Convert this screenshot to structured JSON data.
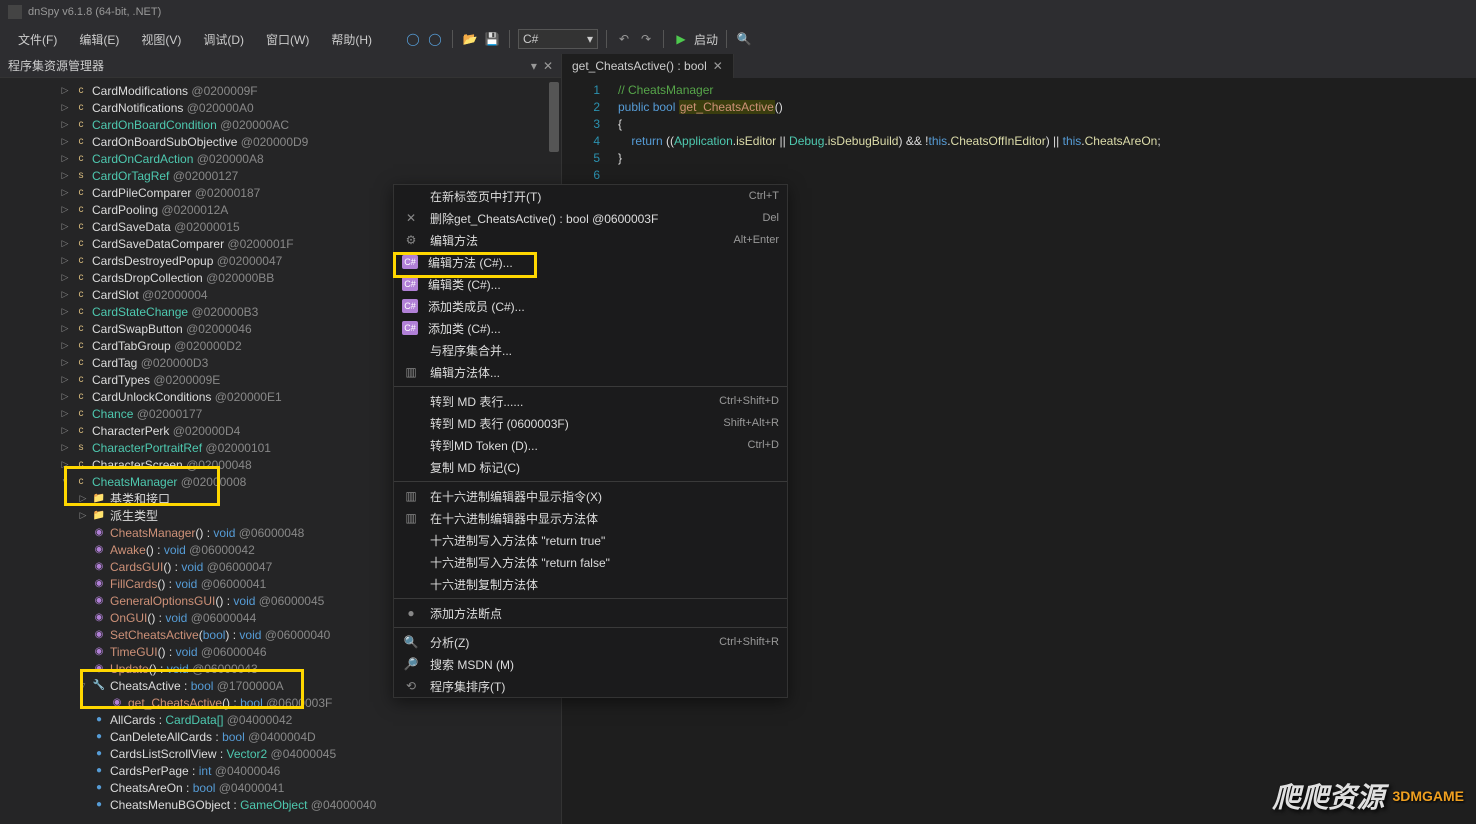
{
  "app": {
    "title": "dnSpy v6.1.8 (64-bit, .NET)"
  },
  "menu": {
    "file": "文件(F)",
    "edit": "编辑(E)",
    "view": "视图(V)",
    "debug": "调试(D)",
    "window": "窗口(W)",
    "help": "帮助(H)",
    "lang": "C#",
    "start": "启动"
  },
  "panel": {
    "title": "程序集资源管理器"
  },
  "items": [
    {
      "d": 0,
      "exp": "▷",
      "ic": "c",
      "icc": "ico-c",
      "nm": "CardModifications",
      "cls": "nm-white",
      "id": "@0200009F"
    },
    {
      "d": 0,
      "exp": "▷",
      "ic": "c",
      "icc": "ico-c",
      "nm": "CardNotifications",
      "cls": "nm-white",
      "id": "@020000A0"
    },
    {
      "d": 0,
      "exp": "▷",
      "ic": "c",
      "icc": "ico-c",
      "nm": "CardOnBoardCondition",
      "cls": "nm",
      "id": "@020000AC"
    },
    {
      "d": 0,
      "exp": "▷",
      "ic": "c",
      "icc": "ico-c",
      "nm": "CardOnBoardSubObjective",
      "cls": "nm-white",
      "id": "@020000D9"
    },
    {
      "d": 0,
      "exp": "▷",
      "ic": "c",
      "icc": "ico-c",
      "nm": "CardOnCardAction",
      "cls": "nm",
      "id": "@020000A8"
    },
    {
      "d": 0,
      "exp": "▷",
      "ic": "s",
      "icc": "ico-c",
      "nm": "CardOrTagRef",
      "cls": "nm",
      "id": "@02000127"
    },
    {
      "d": 0,
      "exp": "▷",
      "ic": "c",
      "icc": "ico-c",
      "nm": "CardPileComparer",
      "cls": "nm-white",
      "id": "@02000187"
    },
    {
      "d": 0,
      "exp": "▷",
      "ic": "c",
      "icc": "ico-c",
      "nm": "CardPooling",
      "cls": "nm-white",
      "id": "@0200012A"
    },
    {
      "d": 0,
      "exp": "▷",
      "ic": "c",
      "icc": "ico-c",
      "nm": "CardSaveData",
      "cls": "nm-white",
      "id": "@02000015"
    },
    {
      "d": 0,
      "exp": "▷",
      "ic": "c",
      "icc": "ico-c",
      "nm": "CardSaveDataComparer",
      "cls": "nm-white",
      "id": "@0200001F"
    },
    {
      "d": 0,
      "exp": "▷",
      "ic": "c",
      "icc": "ico-c",
      "nm": "CardsDestroyedPopup",
      "cls": "nm-white",
      "id": "@02000047"
    },
    {
      "d": 0,
      "exp": "▷",
      "ic": "c",
      "icc": "ico-c",
      "nm": "CardsDropCollection",
      "cls": "nm-white",
      "id": "@020000BB"
    },
    {
      "d": 0,
      "exp": "▷",
      "ic": "c",
      "icc": "ico-c",
      "nm": "CardSlot",
      "cls": "nm-white",
      "id": "@02000004"
    },
    {
      "d": 0,
      "exp": "▷",
      "ic": "c",
      "icc": "ico-c",
      "nm": "CardStateChange",
      "cls": "nm",
      "id": "@020000B3"
    },
    {
      "d": 0,
      "exp": "▷",
      "ic": "c",
      "icc": "ico-c",
      "nm": "CardSwapButton",
      "cls": "nm-white",
      "id": "@02000046"
    },
    {
      "d": 0,
      "exp": "▷",
      "ic": "c",
      "icc": "ico-c",
      "nm": "CardTabGroup",
      "cls": "nm-white",
      "id": "@020000D2"
    },
    {
      "d": 0,
      "exp": "▷",
      "ic": "c",
      "icc": "ico-c",
      "nm": "CardTag",
      "cls": "nm-white",
      "id": "@020000D3"
    },
    {
      "d": 0,
      "exp": "▷",
      "ic": "c",
      "icc": "ico-c",
      "nm": "CardTypes",
      "cls": "nm-white",
      "id": "@0200009E"
    },
    {
      "d": 0,
      "exp": "▷",
      "ic": "c",
      "icc": "ico-c",
      "nm": "CardUnlockConditions",
      "cls": "nm-white",
      "id": "@020000E1"
    },
    {
      "d": 0,
      "exp": "▷",
      "ic": "c",
      "icc": "ico-c",
      "nm": "Chance",
      "cls": "nm",
      "id": "@02000177"
    },
    {
      "d": 0,
      "exp": "▷",
      "ic": "c",
      "icc": "ico-c",
      "nm": "CharacterPerk",
      "cls": "nm-white",
      "id": "@020000D4"
    },
    {
      "d": 0,
      "exp": "▷",
      "ic": "s",
      "icc": "ico-c",
      "nm": "CharacterPortraitRef",
      "cls": "nm",
      "id": "@02000101"
    },
    {
      "d": 0,
      "exp": "▷",
      "ic": "c",
      "icc": "ico-c",
      "nm": "CharacterScreen",
      "cls": "nm-white",
      "id": "@02000048"
    },
    {
      "d": 0,
      "exp": "▿",
      "ic": "c",
      "icc": "ico-c",
      "nm": "CheatsManager",
      "cls": "nm",
      "id": "@02000008"
    },
    {
      "d": 2,
      "exp": "▷",
      "ic": "📁",
      "icc": "ico-f",
      "nm": "基类和接口",
      "cls": "nm-white",
      "id": ""
    },
    {
      "d": 2,
      "exp": "▷",
      "ic": "📁",
      "icc": "ico-f",
      "nm": "派生类型",
      "cls": "nm-white",
      "id": ""
    },
    {
      "d": 2,
      "exp": "",
      "ic": "◉",
      "icc": "ico-m",
      "nm": "CheatsManager",
      "cls": "nm-orange",
      "ret": "void",
      "id": "@06000048",
      "br": true
    },
    {
      "d": 2,
      "exp": "",
      "ic": "◉",
      "icc": "ico-m",
      "nm": "Awake",
      "cls": "nm-orange",
      "ret": "void",
      "id": "@06000042",
      "br": true
    },
    {
      "d": 2,
      "exp": "",
      "ic": "◉",
      "icc": "ico-m",
      "nm": "CardsGUI",
      "cls": "nm-orange",
      "ret": "void",
      "id": "@06000047",
      "br": true
    },
    {
      "d": 2,
      "exp": "",
      "ic": "◉",
      "icc": "ico-m",
      "nm": "FillCards",
      "cls": "nm-orange",
      "ret": "void",
      "id": "@06000041",
      "br": true
    },
    {
      "d": 2,
      "exp": "",
      "ic": "◉",
      "icc": "ico-m",
      "nm": "GeneralOptionsGUI",
      "cls": "nm-orange",
      "ret": "void",
      "id": "@06000045",
      "br": true
    },
    {
      "d": 2,
      "exp": "",
      "ic": "◉",
      "icc": "ico-m",
      "nm": "OnGUI",
      "cls": "nm-orange",
      "ret": "void",
      "id": "@06000044",
      "br": true
    },
    {
      "d": 2,
      "exp": "",
      "ic": "◉",
      "icc": "ico-m",
      "nm": "SetCheatsActive",
      "cls": "nm-orange",
      "ret": "void",
      "args": "bool",
      "id": "@06000040",
      "br": true
    },
    {
      "d": 2,
      "exp": "",
      "ic": "◉",
      "icc": "ico-m",
      "nm": "TimeGUI",
      "cls": "nm-orange",
      "ret": "void",
      "id": "@06000046",
      "br": true
    },
    {
      "d": 2,
      "exp": "",
      "ic": "◉",
      "icc": "ico-m",
      "nm": "Update",
      "cls": "nm-orange",
      "ret": "void",
      "id": "@06000043",
      "br": true
    },
    {
      "d": 2,
      "exp": "▿",
      "ic": "🔧",
      "icc": "ico-p",
      "nm": "CheatsActive",
      "cls": "nm-white",
      "ty": "bool",
      "id": "@1700000A",
      "prop": true
    },
    {
      "d": 3,
      "exp": "",
      "ic": "◉",
      "icc": "ico-m",
      "nm": "get_CheatsActive",
      "cls": "nm-orange",
      "ret": "bool",
      "id": "@0600003F",
      "br": true
    },
    {
      "d": 2,
      "exp": "",
      "ic": "●",
      "icc": "ico-fd",
      "nm": "AllCards",
      "cls": "nm-white",
      "ty": "CardData[]",
      "id": "@04000042",
      "fld": true
    },
    {
      "d": 2,
      "exp": "",
      "ic": "●",
      "icc": "ico-fd",
      "nm": "CanDeleteAllCards",
      "cls": "nm-white",
      "ty": "bool",
      "id": "@0400004D",
      "fld": true
    },
    {
      "d": 2,
      "exp": "",
      "ic": "●",
      "icc": "ico-fd",
      "nm": "CardsListScrollView",
      "cls": "nm-white",
      "ty": "Vector2",
      "id": "@04000045",
      "fld": true
    },
    {
      "d": 2,
      "exp": "",
      "ic": "●",
      "icc": "ico-fd",
      "nm": "CardsPerPage",
      "cls": "nm-white",
      "ty": "int",
      "id": "@04000046",
      "fld": true
    },
    {
      "d": 2,
      "exp": "",
      "ic": "●",
      "icc": "ico-fd",
      "nm": "CheatsAreOn",
      "cls": "nm-white",
      "ty": "bool",
      "id": "@04000041",
      "fld": true
    },
    {
      "d": 2,
      "exp": "",
      "ic": "●",
      "icc": "ico-fd",
      "nm": "CheatsMenuBGObject",
      "cls": "nm-white",
      "ty": "GameObject",
      "id": "@04000040",
      "fld": true
    }
  ],
  "tab": {
    "label": "get_CheatsActive() : bool"
  },
  "code": {
    "l1": "// CheatsManager",
    "kw_public": "public",
    "kw_bool": "bool",
    "method": "get_CheatsActive",
    "kw_return": "return",
    "ty_app": "Application",
    "p_ise": "isEditor",
    "ty_dbg": "Debug",
    "p_idb": "isDebugBuild",
    "kw_this": "this",
    "p_coe": "CheatsOffInEditor",
    "p_cao": "CheatsAreOn"
  },
  "ctx": [
    {
      "ic": "",
      "lbl": "在新标签页中打开(T)",
      "sc": "Ctrl+T"
    },
    {
      "ic": "✕",
      "lbl": "删除get_CheatsActive() : bool @0600003F",
      "sc": "Del"
    },
    {
      "ic": "⚙",
      "lbl": "编辑方法",
      "sc": "Alt+Enter"
    },
    {
      "ic": "C#",
      "lbl": "编辑方法 (C#)...",
      "sc": "",
      "cs": true
    },
    {
      "ic": "C#",
      "lbl": "编辑类 (C#)...",
      "sc": "",
      "cs": true
    },
    {
      "ic": "C#",
      "lbl": "添加类成员 (C#)...",
      "sc": "",
      "cs": true
    },
    {
      "ic": "C#",
      "lbl": "添加类 (C#)...",
      "sc": "",
      "cs": true
    },
    {
      "ic": "",
      "lbl": "与程序集合并...",
      "sc": ""
    },
    {
      "ic": "▥",
      "lbl": "编辑方法体...",
      "sc": ""
    },
    {
      "sep": true
    },
    {
      "ic": "",
      "lbl": "转到 MD 表行......",
      "sc": "Ctrl+Shift+D"
    },
    {
      "ic": "",
      "lbl": "转到 MD 表行 (0600003F)",
      "sc": "Shift+Alt+R"
    },
    {
      "ic": "",
      "lbl": "转到MD Token (D)...",
      "sc": "Ctrl+D"
    },
    {
      "ic": "",
      "lbl": "复制 MD 标记(C)",
      "sc": ""
    },
    {
      "sep": true
    },
    {
      "ic": "▥",
      "lbl": "在十六进制编辑器中显示指令(X)",
      "sc": ""
    },
    {
      "ic": "▥",
      "lbl": "在十六进制编辑器中显示方法体",
      "sc": ""
    },
    {
      "ic": "",
      "lbl": "十六进制写入方法体 \"return true\"",
      "sc": ""
    },
    {
      "ic": "",
      "lbl": "十六进制写入方法体 \"return false\"",
      "sc": ""
    },
    {
      "ic": "",
      "lbl": "十六进制复制方法体",
      "sc": ""
    },
    {
      "sep": true
    },
    {
      "ic": "●",
      "lbl": "添加方法断点",
      "sc": ""
    },
    {
      "sep": true
    },
    {
      "ic": "🔍",
      "lbl": "分析(Z)",
      "sc": "Ctrl+Shift+R"
    },
    {
      "ic": "🔎",
      "lbl": "搜索 MSDN (M)",
      "sc": ""
    },
    {
      "ic": "⟲",
      "lbl": "程序集排序(T)",
      "sc": ""
    }
  ],
  "wm": {
    "txt": "爬爬资源",
    "badge": "3DMGAME"
  }
}
